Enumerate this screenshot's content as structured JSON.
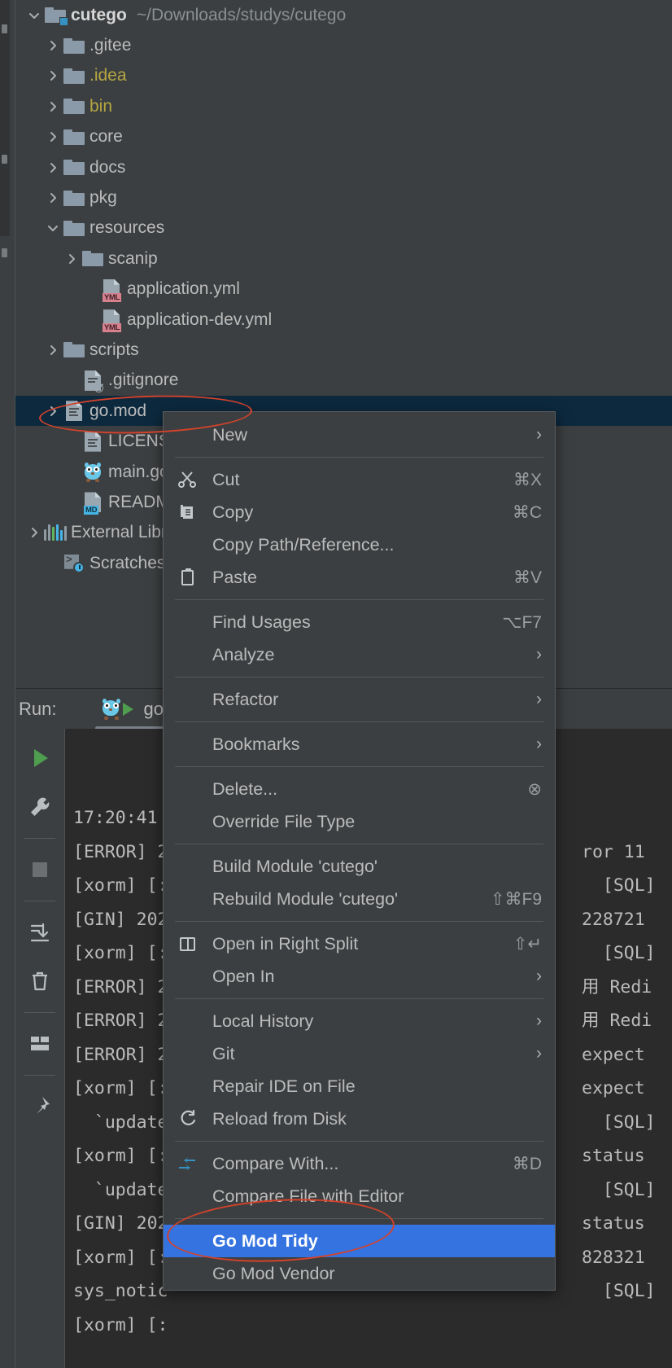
{
  "app": {
    "theme_bg": "#3c3f41",
    "console_bg": "#2b2b2b",
    "selection_bg": "#0d293e",
    "menu_highlight": "#3573e0",
    "accent_red": "#d4422a"
  },
  "project_tree": {
    "root": {
      "label": "cutego",
      "path": "~/Downloads/studys/cutego",
      "icon": "module-folder-icon",
      "expanded": true
    },
    "items": [
      {
        "label": ".gitee",
        "icon": "folder-icon",
        "indent": 1,
        "arrow": "right",
        "color": "normal"
      },
      {
        "label": ".idea",
        "icon": "folder-icon",
        "indent": 1,
        "arrow": "right",
        "color": "yellow"
      },
      {
        "label": "bin",
        "icon": "folder-icon",
        "indent": 1,
        "arrow": "right",
        "color": "yellow"
      },
      {
        "label": "core",
        "icon": "folder-icon",
        "indent": 1,
        "arrow": "right",
        "color": "normal"
      },
      {
        "label": "docs",
        "icon": "folder-icon",
        "indent": 1,
        "arrow": "right",
        "color": "normal"
      },
      {
        "label": "pkg",
        "icon": "folder-icon",
        "indent": 1,
        "arrow": "right",
        "color": "normal"
      },
      {
        "label": "resources",
        "icon": "folder-icon",
        "indent": 1,
        "arrow": "down",
        "color": "normal"
      },
      {
        "label": "scanip",
        "icon": "folder-icon",
        "indent": 2,
        "arrow": "right",
        "color": "normal"
      },
      {
        "label": "application.yml",
        "icon": "yml-file-icon",
        "indent": 3,
        "arrow": "none",
        "color": "normal"
      },
      {
        "label": "application-dev.yml",
        "icon": "yml-file-icon",
        "indent": 3,
        "arrow": "none",
        "color": "normal"
      },
      {
        "label": "scripts",
        "icon": "folder-icon",
        "indent": 1,
        "arrow": "right",
        "color": "normal"
      },
      {
        "label": ".gitignore",
        "icon": "gitignore-icon",
        "indent": 2,
        "arrow": "none",
        "color": "normal"
      },
      {
        "label": "go.mod",
        "icon": "text-file-icon",
        "indent": 1,
        "arrow": "right",
        "color": "normal",
        "selected": true
      },
      {
        "label": "LICENSE",
        "icon": "text-file-icon",
        "indent": 2,
        "arrow": "none",
        "color": "normal"
      },
      {
        "label": "main.go",
        "icon": "go-gopher-icon",
        "indent": 2,
        "arrow": "none",
        "color": "normal"
      },
      {
        "label": "README.md",
        "icon": "md-file-icon",
        "indent": 2,
        "arrow": "none",
        "color": "normal"
      },
      {
        "label": "External Libraries",
        "icon": "libraries-icon",
        "indent": 0,
        "arrow": "right",
        "color": "normal"
      },
      {
        "label": "Scratches and Consoles",
        "icon": "scratches-icon",
        "indent": 1,
        "arrow": "none",
        "color": "normal"
      }
    ]
  },
  "context_menu": {
    "groups": [
      {
        "items": [
          {
            "label": "New",
            "icon": "none",
            "shortcut": "",
            "submenu": true
          }
        ]
      },
      {
        "items": [
          {
            "label": "Cut",
            "icon": "scissors-icon",
            "shortcut": "⌘X",
            "submenu": false
          },
          {
            "label": "Copy",
            "icon": "copy-icon",
            "shortcut": "⌘C",
            "submenu": false
          },
          {
            "label": "Copy Path/Reference...",
            "icon": "none",
            "shortcut": "",
            "submenu": false
          },
          {
            "label": "Paste",
            "icon": "paste-icon",
            "shortcut": "⌘V",
            "submenu": false
          }
        ]
      },
      {
        "items": [
          {
            "label": "Find Usages",
            "icon": "none",
            "shortcut": "⌥F7",
            "submenu": false
          },
          {
            "label": "Analyze",
            "icon": "none",
            "shortcut": "",
            "submenu": true
          }
        ]
      },
      {
        "items": [
          {
            "label": "Refactor",
            "icon": "none",
            "shortcut": "",
            "submenu": true
          }
        ]
      },
      {
        "items": [
          {
            "label": "Bookmarks",
            "icon": "none",
            "shortcut": "",
            "submenu": true
          }
        ]
      },
      {
        "items": [
          {
            "label": "Delete...",
            "icon": "none",
            "shortcut": "⊗",
            "submenu": false
          },
          {
            "label": "Override File Type",
            "icon": "none",
            "shortcut": "",
            "submenu": false
          }
        ]
      },
      {
        "items": [
          {
            "label": "Build Module 'cutego'",
            "icon": "none",
            "shortcut": "",
            "submenu": false
          },
          {
            "label": "Rebuild Module 'cutego'",
            "icon": "none",
            "shortcut": "⇧⌘F9",
            "submenu": false
          }
        ]
      },
      {
        "items": [
          {
            "label": "Open in Right Split",
            "icon": "split-icon",
            "shortcut": "⇧↵",
            "submenu": false
          },
          {
            "label": "Open In",
            "icon": "none",
            "shortcut": "",
            "submenu": true
          }
        ]
      },
      {
        "items": [
          {
            "label": "Local History",
            "icon": "none",
            "shortcut": "",
            "submenu": true
          },
          {
            "label": "Git",
            "icon": "none",
            "shortcut": "",
            "submenu": true
          },
          {
            "label": "Repair IDE on File",
            "icon": "none",
            "shortcut": "",
            "submenu": false
          },
          {
            "label": "Reload from Disk",
            "icon": "reload-icon",
            "shortcut": "",
            "submenu": false
          }
        ]
      },
      {
        "items": [
          {
            "label": "Compare With...",
            "icon": "compare-icon",
            "shortcut": "⌘D",
            "submenu": false
          },
          {
            "label": "Compare File with Editor",
            "icon": "none",
            "shortcut": "",
            "submenu": false
          }
        ]
      },
      {
        "items": [
          {
            "label": "Go Mod Tidy",
            "icon": "none",
            "shortcut": "",
            "submenu": false,
            "highlighted": true
          },
          {
            "label": "Go Mod Vendor",
            "icon": "none",
            "shortcut": "",
            "submenu": false
          }
        ]
      }
    ]
  },
  "run_panel": {
    "title": "Run:",
    "tab_label": "go build ...",
    "tools": [
      "run-icon",
      "wrench-icon",
      "stop-icon",
      "scroll-to-end-icon",
      "trash-icon",
      "layout-icon",
      "pin-icon"
    ],
    "console_left": [
      "17:20:41",
      "[ERROR] 2",
      "[xorm] [:",
      "[GIN] 202",
      "[xorm] [:",
      "[ERROR] 2",
      "[ERROR] 2",
      "[ERROR] 2",
      "[xorm] [:",
      "  `update_",
      "[xorm] [:",
      "  `update_",
      "[GIN] 202",
      "[xorm] [:",
      "sys_notic",
      "[xorm] [:"
    ],
    "console_right": [
      "",
      "ror 11",
      "  [SQL]",
      "228721",
      "  [SQL]",
      "用 Redi",
      "用 Redi",
      "expect",
      "expect",
      "  [SQL]",
      "status",
      "  [SQL]",
      "status",
      "828321",
      "  [SQL]",
      ""
    ]
  },
  "annotations": [
    {
      "name": "ellipse-go-mod",
      "shape": "ellipse"
    },
    {
      "name": "ellipse-go-mod-tidy",
      "shape": "ellipse"
    }
  ]
}
